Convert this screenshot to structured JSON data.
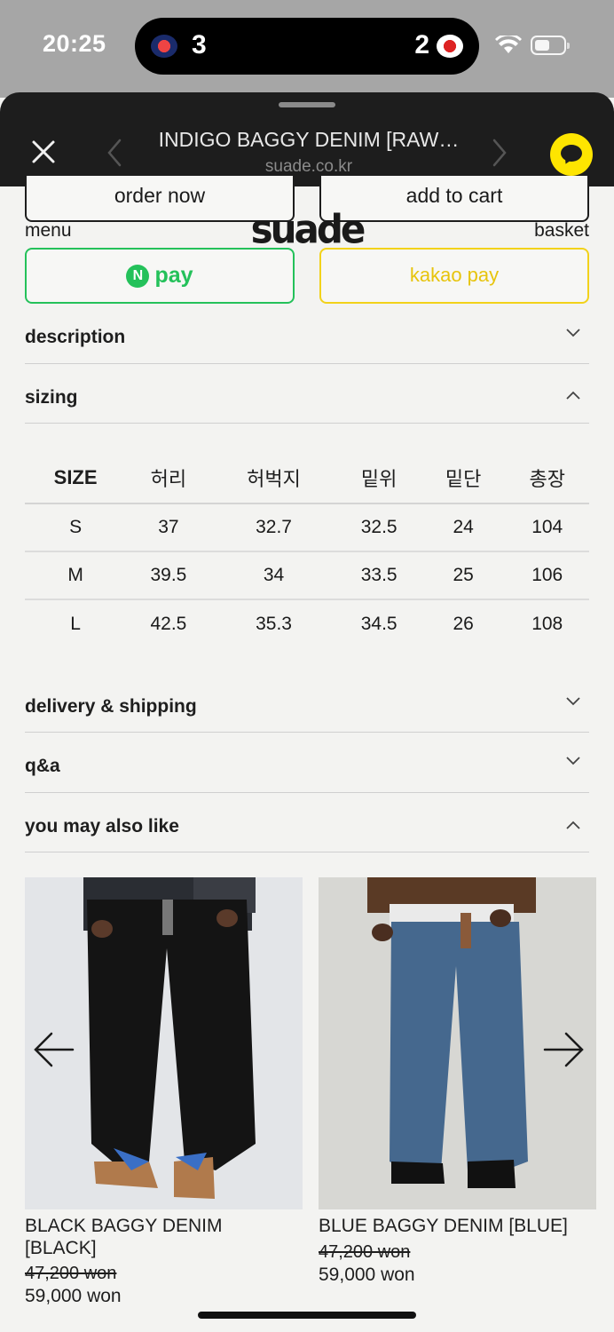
{
  "status_bar": {
    "time": "20:25",
    "score_left": "3",
    "score_right": "2",
    "team_left_icon": "giants-logo-icon",
    "team_right_icon": "wins-logo-icon"
  },
  "browser": {
    "title": "INDIGO BAGGY DENIM [RAW…",
    "domain": "suade.co.kr"
  },
  "actions": {
    "order_now": "order now",
    "add_to_cart": "add to cart",
    "menu": "menu",
    "basket": "basket",
    "logo": "suade",
    "npay_badge": "N",
    "npay_label": "pay",
    "kakaopay_label": "kakao pay"
  },
  "sections": {
    "description": "description",
    "sizing": "sizing",
    "delivery": "delivery & shipping",
    "qa": "q&a",
    "also_like": "you may also like"
  },
  "size_table": {
    "headers": [
      "SIZE",
      "허리",
      "허벅지",
      "밑위",
      "밑단",
      "총장"
    ],
    "rows": [
      [
        "S",
        "37",
        "32.7",
        "32.5",
        "24",
        "104"
      ],
      [
        "M",
        "39.5",
        "34",
        "33.5",
        "25",
        "106"
      ],
      [
        "L",
        "42.5",
        "35.3",
        "34.5",
        "26",
        "108"
      ]
    ]
  },
  "products": [
    {
      "name": "BLACK BAGGY DENIM [BLACK]",
      "old_price": "47,200 won",
      "price": "59,000 won"
    },
    {
      "name": "BLUE BAGGY DENIM [BLUE]",
      "old_price": "47,200 won",
      "price": "59,000 won"
    }
  ],
  "colors": {
    "npay_green": "#24c15a",
    "kakao_yellow": "#fee500",
    "header_dark": "#1d1d1d"
  }
}
